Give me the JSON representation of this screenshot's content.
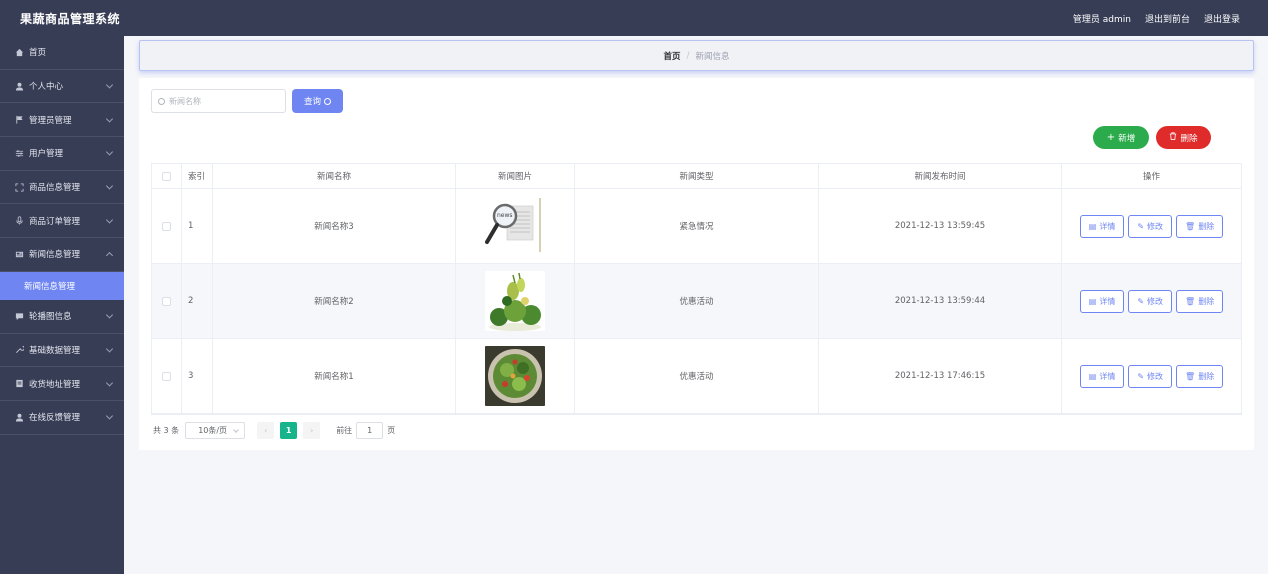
{
  "app": {
    "title": "果蔬商品管理系统",
    "user_label": "管理员 admin",
    "to_front_label": "退出到前台",
    "logout_label": "退出登录"
  },
  "sidebar": {
    "items": [
      {
        "label": "首页",
        "icon": "home-icon"
      },
      {
        "label": "个人中心",
        "icon": "user-icon"
      },
      {
        "label": "管理员管理",
        "icon": "flag-icon"
      },
      {
        "label": "用户管理",
        "icon": "sliders-icon"
      },
      {
        "label": "商品信息管理",
        "icon": "expand-icon"
      },
      {
        "label": "商品订单管理",
        "icon": "microphone-icon"
      },
      {
        "label": "新闻信息管理",
        "icon": "newspaper-icon"
      },
      {
        "label": "新闻信息管理",
        "icon": "none"
      },
      {
        "label": "轮播图信息",
        "icon": "chat-icon"
      },
      {
        "label": "基础数据管理",
        "icon": "tool-icon"
      },
      {
        "label": "收货地址管理",
        "icon": "box-icon"
      },
      {
        "label": "在线反馈管理",
        "icon": "user-icon"
      }
    ]
  },
  "breadcrumb": {
    "home": "首页",
    "separator": "/",
    "current": "新闻信息"
  },
  "search": {
    "placeholder": "新闻名称",
    "button_label": "查询"
  },
  "actions": {
    "add_label": "新增",
    "delete_label": "删除"
  },
  "table": {
    "headers": [
      "索引",
      "新闻名称",
      "新闻图片",
      "新闻类型",
      "新闻发布时间",
      "操作"
    ],
    "rows": [
      {
        "index": "1",
        "name": "新闻名称3",
        "image": "news-magnifier-image",
        "type": "紧急情况",
        "time": "2021-12-13 13:59:45"
      },
      {
        "index": "2",
        "name": "新闻名称2",
        "image": "vegetables-image",
        "type": "优惠活动",
        "time": "2021-12-13 13:59:44"
      },
      {
        "index": "3",
        "name": "新闻名称1",
        "image": "salad-bowl-image",
        "type": "优惠活动",
        "time": "2021-12-13 17:46:15"
      }
    ],
    "row_actions": {
      "detail": "详情",
      "edit": "修改",
      "delete": "删除"
    }
  },
  "pagination": {
    "total": "共 3 条",
    "page_size": "10条/页",
    "current_page": "1",
    "goto_prefix": "前往",
    "goto_value": "1",
    "goto_suffix": "页"
  },
  "colors": {
    "topbar": "#373d55",
    "accent": "#6f86f2",
    "add": "#2bab4b",
    "delete": "#e02b2b",
    "page_active": "#17b38a"
  }
}
